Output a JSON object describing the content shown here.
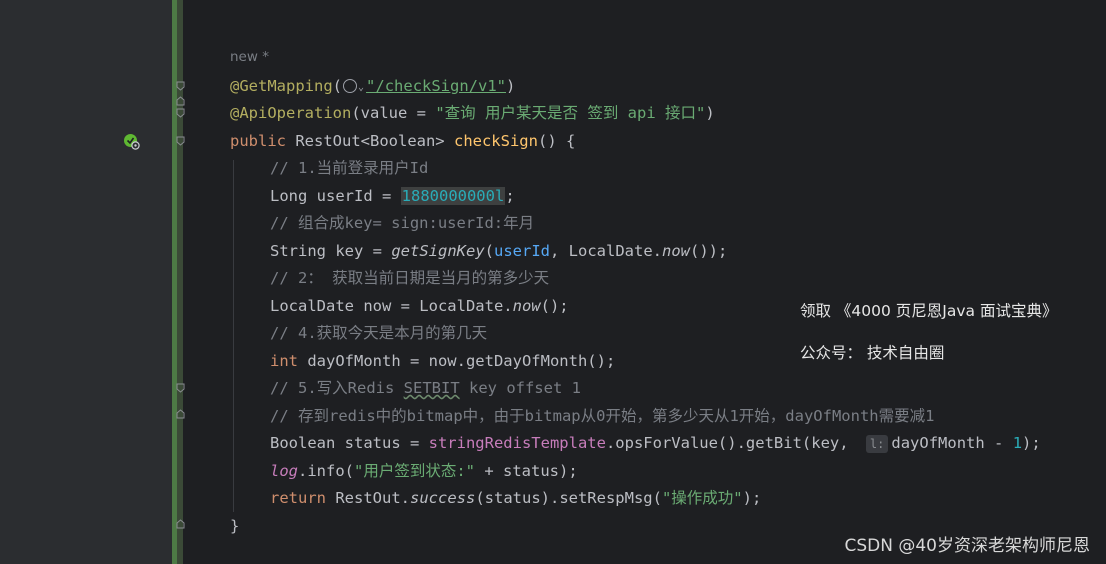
{
  "editor": {
    "new_hint": "new *",
    "lines": {
      "l1": {
        "annotation": "@GetMapping",
        "open": "(",
        "url": "\"/checkSign/v1\"",
        "close": ")"
      },
      "l2": {
        "annotation": "@ApiOperation",
        "param": "(value = ",
        "value": "\"查询 用户某天是否 签到 api 接口\"",
        "close": ")"
      },
      "l3": {
        "kw": "public",
        "type": " RestOut<Boolean> ",
        "method": "checkSign",
        "rest": "() {"
      },
      "l4": {
        "comment": "// 1.当前登录用户Id"
      },
      "l5": {
        "decl": "Long userId = ",
        "num": "1880000000l",
        "end": ";"
      },
      "l6": {
        "comment": "// 组合成key= sign:userId:年月"
      },
      "l7": {
        "decl": "String key = ",
        "call": "getSignKey",
        "open": "(",
        "arg": "userId",
        "mid": ", LocalDate.",
        "now": "now",
        "end": "());"
      },
      "l8": {
        "comment": "// 2： 获取当前日期是当月的第多少天"
      },
      "l9": {
        "decl": "LocalDate now = LocalDate.",
        "now": "now",
        "end": "();"
      },
      "l10": {
        "comment": "// 4.获取今天是本月的第几天"
      },
      "l11": {
        "kw": "int",
        "rest": " dayOfMonth = now.getDayOfMonth();"
      },
      "l12": {
        "comment_a": "// 5.写入Redis ",
        "comment_b": "SETBIT",
        "comment_c": " key offset 1"
      },
      "l13": {
        "comment": "// 存到redis中的bitmap中，由于bitmap从0开始，第多少天从1开始，dayOfMonth需要减1"
      },
      "l14": {
        "decl": "Boolean status = ",
        "field": "stringRedisTemplate",
        "mid": ".opsForValue().getBit(key, ",
        "hint": "l:",
        "arg": "dayOfMonth - ",
        "num": "1",
        "end": ");"
      },
      "l15": {
        "log": "log",
        "rest": ".info(",
        "str": "\"用户签到状态:\"",
        "end": " + status);"
      },
      "l16": {
        "kw": "return",
        "a": " RestOut.",
        "success": "success",
        "b": "(status).setRespMsg(",
        "str": "\"操作成功\"",
        "end": ");"
      },
      "l17": {
        "brace": "}"
      }
    }
  },
  "overlay": {
    "promo_line1": "领取 《4000 页尼恩Java 面试宝典》",
    "promo_line2": "公众号： 技术自由圈",
    "watermark": "CSDN @40岁资深老架构师尼恩"
  },
  "colors": {
    "background": "#1e1f22",
    "gutter": "#2b2d30",
    "annotation": "#b3ae60",
    "string": "#6aab73",
    "keyword": "#cf8e6d",
    "comment": "#7a7e85",
    "number": "#2aacb8",
    "method": "#ffc66d",
    "field": "#c77dbb"
  }
}
